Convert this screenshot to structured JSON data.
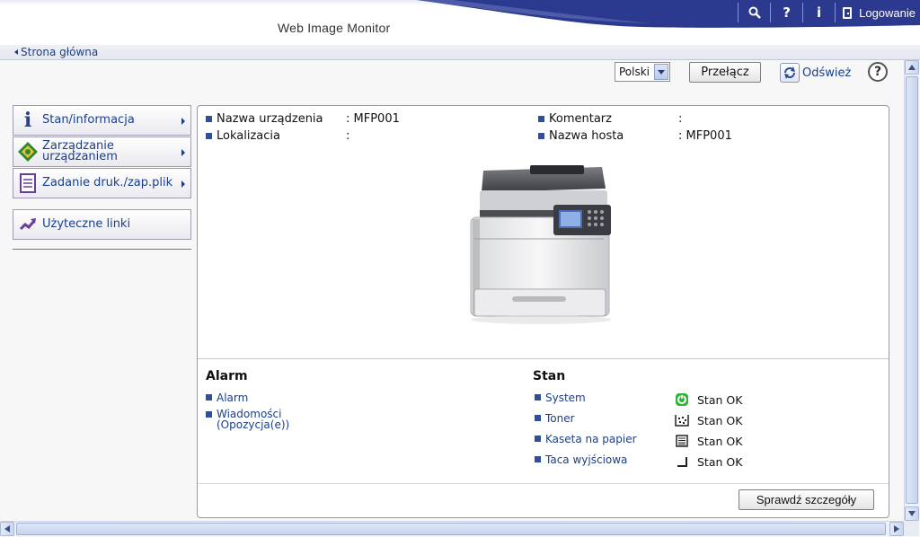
{
  "header": {
    "app_title": "Web Image Monitor",
    "login_label": "Logowanie",
    "icons": [
      "search-icon",
      "help-icon",
      "info-icon",
      "login-door-icon"
    ],
    "colors": {
      "band": "#2b3a8f",
      "band_light": "#5b66b5"
    }
  },
  "breadcrumb": {
    "home_label": "Strona główna"
  },
  "toolbar": {
    "language_value": "Polski",
    "switch_label": "Przełącz",
    "refresh_label": "Odśwież",
    "help_symbol": "?"
  },
  "sidebar": {
    "items": [
      {
        "label": "Stan/informacja",
        "icon": "info-icon"
      },
      {
        "label_line1": "Zarządzanie",
        "label_line2": "urządzaniem",
        "icon": "device-management-icon"
      },
      {
        "label": "Zadanie druk./zap.plik",
        "icon": "job-document-icon"
      }
    ],
    "links_label": "Użyteczne linki",
    "links_icon": "link-arrow-icon"
  },
  "device_info": {
    "name_label": "Nazwa urządzenia",
    "name_value": ": MFP001",
    "location_label": "Lokalizacia",
    "location_value": ":",
    "comment_label": "Komentarz",
    "comment_value": ":",
    "hostname_label": "Nazwa hosta",
    "hostname_value": ": MFP001"
  },
  "alarm": {
    "title": "Alarm",
    "links": [
      {
        "label": "Alarm"
      },
      {
        "label_line1": "Wiadomości",
        "label_line2": "(Opozycja(e))"
      }
    ]
  },
  "status": {
    "title": "Stan",
    "rows": [
      {
        "label": "System",
        "value": "Stan OK",
        "icon": "system-ok-icon",
        "color": "#2fb232"
      },
      {
        "label": "Toner",
        "value": "Stan OK",
        "icon": "toner-icon"
      },
      {
        "label": "Kaseta na papier",
        "value": "Stan OK",
        "icon": "paper-tray-icon"
      },
      {
        "label": "Taca wyjściowa",
        "value": "Stan OK",
        "icon": "output-tray-icon"
      }
    ]
  },
  "actions": {
    "details_label": "Sprawdź szczegóły"
  }
}
